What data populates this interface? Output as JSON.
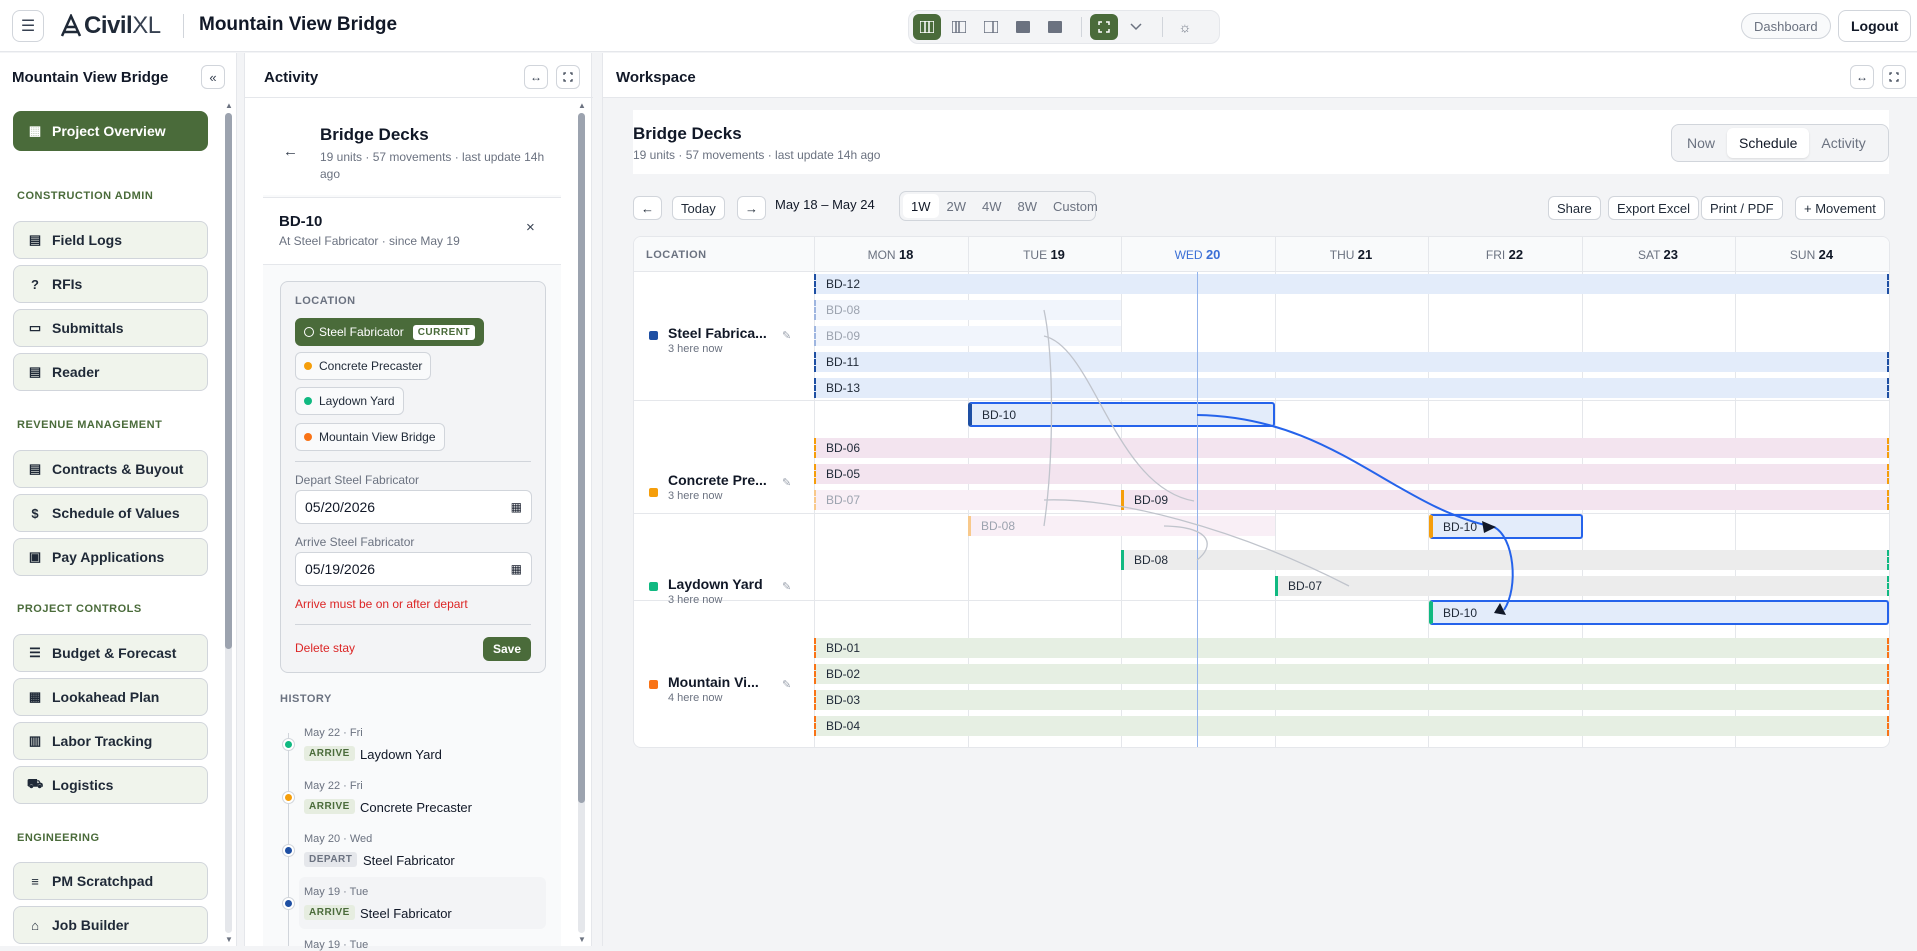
{
  "app": {
    "brand_main": "CivilXL",
    "brand_prefix": "Civil",
    "brand_suffix": "XL",
    "title": "Mountain View Bridge",
    "dashboard": "Dashboard",
    "logout": "Logout"
  },
  "sidebar": {
    "title": "Mountain View Bridge",
    "collapse": "«",
    "active": "Project Overview",
    "sections": {
      "construction_admin": "CONSTRUCTION ADMIN",
      "revenue": "REVENUE MANAGEMENT",
      "controls": "PROJECT CONTROLS",
      "engineering": "ENGINEERING"
    },
    "items": {
      "field_logs": "Field Logs",
      "rfis": "RFIs",
      "submittals": "Submittals",
      "reader": "Reader",
      "contracts": "Contracts & Buyout",
      "sov": "Schedule of Values",
      "pay_apps": "Pay Applications",
      "budget": "Budget & Forecast",
      "lookahead": "Lookahead Plan",
      "labor": "Labor Tracking",
      "logistics": "Logistics",
      "pm_scratch": "PM Scratchpad",
      "job_builder": "Job Builder"
    }
  },
  "activity": {
    "title": "Activity",
    "group_title": "Bridge Decks",
    "group_sub": "19 units · 57 movements · last update 14h ago",
    "unit": "BD-10",
    "unit_sub": "At Steel Fabricator · since May 19",
    "location_label": "LOCATION",
    "locations": {
      "current": "Steel Fabricator",
      "current_badge": "CURRENT",
      "l2": "Concrete Precaster",
      "l3": "Laydown Yard",
      "l4": "Mountain View Bridge"
    },
    "depart_label": "Depart Steel Fabricator",
    "depart_value": "05/20/2026",
    "arrive_label": "Arrive Steel Fabricator",
    "arrive_value": "05/19/2026",
    "error": "Arrive must be on or after depart",
    "delete": "Delete stay",
    "save": "Save",
    "history_label": "HISTORY",
    "history": [
      {
        "date": "May 22 · Fri",
        "type": "ARRIVE",
        "place": "Laydown Yard"
      },
      {
        "date": "May 22 · Fri",
        "type": "ARRIVE",
        "place": "Concrete Precaster"
      },
      {
        "date": "May 20 · Wed",
        "type": "DEPART",
        "place": "Steel Fabricator"
      },
      {
        "date": "May 19 · Tue",
        "type": "ARRIVE",
        "place": "Steel Fabricator"
      },
      {
        "date": "May 19 · Tue"
      }
    ]
  },
  "workspace": {
    "title": "Workspace",
    "group_title": "Bridge Decks",
    "group_sub": "19 units · 57 movements · last update 14h ago",
    "views": {
      "now": "Now",
      "schedule": "Schedule",
      "activity": "Activity"
    },
    "today": "Today",
    "range": "May 18 – May 24",
    "ranges": {
      "w1": "1W",
      "w2": "2W",
      "w4": "4W",
      "w8": "8W",
      "custom": "Custom"
    },
    "share": "Share",
    "excel": "Export Excel",
    "print": "Print / PDF",
    "movement": "+ Movement",
    "location_col": "LOCATION",
    "days": [
      {
        "dow": "MON",
        "num": "18"
      },
      {
        "dow": "TUE",
        "num": "19"
      },
      {
        "dow": "WED",
        "num": "20"
      },
      {
        "dow": "THU",
        "num": "21"
      },
      {
        "dow": "FRI",
        "num": "22"
      },
      {
        "dow": "SAT",
        "num": "23"
      },
      {
        "dow": "SUN",
        "num": "24"
      }
    ],
    "rows": [
      {
        "name": "Steel Fabrica...",
        "count": "3 here now",
        "color": "#1e4fa3"
      },
      {
        "name": "Concrete Pre...",
        "count": "3 here now",
        "color": "#f59e0b"
      },
      {
        "name": "Laydown Yard",
        "count": "3 here now",
        "color": "#10b981"
      },
      {
        "name": "Mountain Vi...",
        "count": "4 here now",
        "color": "#f97316"
      }
    ],
    "bars": {
      "bd12": "BD-12",
      "bd08a": "BD-08",
      "bd09a": "BD-09",
      "bd11": "BD-11",
      "bd13": "BD-13",
      "bd10a": "BD-10",
      "bd06": "BD-06",
      "bd05": "BD-05",
      "bd07a": "BD-07",
      "bd09b": "BD-09",
      "bd08b": "BD-08",
      "bd10b": "BD-10",
      "bd08c": "BD-08",
      "bd07b": "BD-07",
      "bd10c": "BD-10",
      "bd01": "BD-01",
      "bd02": "BD-02",
      "bd03": "BD-03",
      "bd04": "BD-04"
    }
  },
  "colors": {
    "accent": "#4a6b3a",
    "today": "#3b6fd6",
    "steel": "#1e4fa3",
    "precast": "#f59e0b",
    "laydown": "#10b981",
    "bridge": "#f97316",
    "danger": "#dc2626"
  }
}
